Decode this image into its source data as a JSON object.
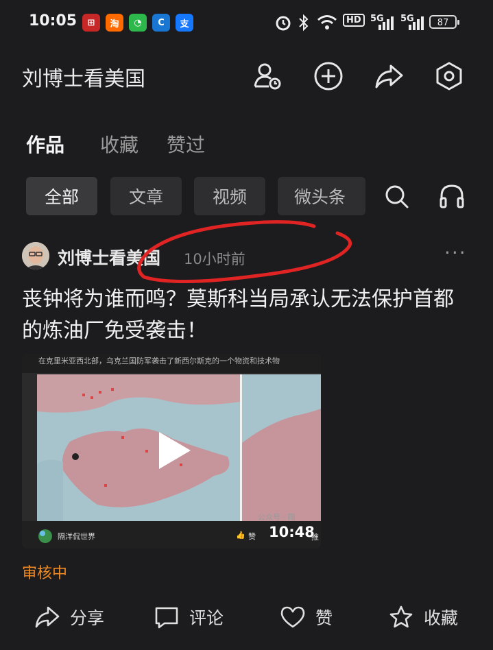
{
  "status_bar": {
    "time": "10:05",
    "network_label": "HD",
    "signal1": "5G",
    "signal2": "5G",
    "battery": "87",
    "notification_icons": [
      "app-icon-red",
      "taobao-icon",
      "wechat-pay-icon",
      "browser-icon",
      "alipay-icon"
    ],
    "right_icons": [
      "alarm-icon",
      "bluetooth-icon",
      "wifi-icon"
    ]
  },
  "header": {
    "title": "刘博士看美国",
    "icons": [
      "profile-history-icon",
      "add-icon",
      "share-icon",
      "settings-icon"
    ]
  },
  "tabs": [
    {
      "label": "作品",
      "active": true
    },
    {
      "label": "收藏",
      "active": false
    },
    {
      "label": "赞过",
      "active": false
    }
  ],
  "filters": [
    {
      "label": "全部",
      "active": true
    },
    {
      "label": "文章",
      "active": false
    },
    {
      "label": "视频",
      "active": false
    },
    {
      "label": "微头条",
      "active": false
    }
  ],
  "filter_icons": [
    "search-icon",
    "headphones-icon"
  ],
  "post": {
    "author": "刘博士看美国",
    "time": "10小时前",
    "title": "丧钟将为谁而鸣？莫斯科当局承认无法保护首都的炼油厂免受袭击！",
    "video": {
      "caption": "在克里米亚西北部，乌克兰国防军袭击了新西尔斯克的一个物资和技术物",
      "source": "隔洋侃世界",
      "like_label": "赞",
      "duration": "10:48",
      "watermark": "公众号 · 隔",
      "recommend_label": "推"
    },
    "status": "审核中"
  },
  "actions": [
    {
      "label": "分享",
      "icon": "share-arrow-icon"
    },
    {
      "label": "评论",
      "icon": "comment-icon"
    },
    {
      "label": "赞",
      "icon": "heart-icon"
    },
    {
      "label": "收藏",
      "icon": "star-icon"
    }
  ],
  "colors": {
    "background": "#1c1c1e",
    "chip": "#2e2e30",
    "status_orange": "#f08a24",
    "annotation_red": "#e02424"
  }
}
